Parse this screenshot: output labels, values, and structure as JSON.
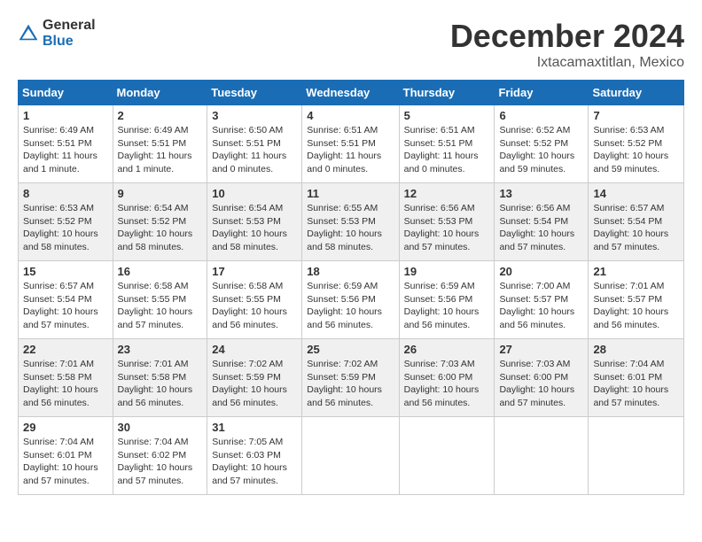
{
  "header": {
    "logo_general": "General",
    "logo_blue": "Blue",
    "month_title": "December 2024",
    "location": "Ixtacamaxtitlan, Mexico"
  },
  "weekdays": [
    "Sunday",
    "Monday",
    "Tuesday",
    "Wednesday",
    "Thursday",
    "Friday",
    "Saturday"
  ],
  "weeks": [
    [
      {
        "day": "1",
        "sunrise": "6:49 AM",
        "sunset": "5:51 PM",
        "daylight": "11 hours and 1 minute."
      },
      {
        "day": "2",
        "sunrise": "6:49 AM",
        "sunset": "5:51 PM",
        "daylight": "11 hours and 1 minute."
      },
      {
        "day": "3",
        "sunrise": "6:50 AM",
        "sunset": "5:51 PM",
        "daylight": "11 hours and 0 minutes."
      },
      {
        "day": "4",
        "sunrise": "6:51 AM",
        "sunset": "5:51 PM",
        "daylight": "11 hours and 0 minutes."
      },
      {
        "day": "5",
        "sunrise": "6:51 AM",
        "sunset": "5:51 PM",
        "daylight": "11 hours and 0 minutes."
      },
      {
        "day": "6",
        "sunrise": "6:52 AM",
        "sunset": "5:52 PM",
        "daylight": "10 hours and 59 minutes."
      },
      {
        "day": "7",
        "sunrise": "6:53 AM",
        "sunset": "5:52 PM",
        "daylight": "10 hours and 59 minutes."
      }
    ],
    [
      {
        "day": "8",
        "sunrise": "6:53 AM",
        "sunset": "5:52 PM",
        "daylight": "10 hours and 58 minutes."
      },
      {
        "day": "9",
        "sunrise": "6:54 AM",
        "sunset": "5:52 PM",
        "daylight": "10 hours and 58 minutes."
      },
      {
        "day": "10",
        "sunrise": "6:54 AM",
        "sunset": "5:53 PM",
        "daylight": "10 hours and 58 minutes."
      },
      {
        "day": "11",
        "sunrise": "6:55 AM",
        "sunset": "5:53 PM",
        "daylight": "10 hours and 58 minutes."
      },
      {
        "day": "12",
        "sunrise": "6:56 AM",
        "sunset": "5:53 PM",
        "daylight": "10 hours and 57 minutes."
      },
      {
        "day": "13",
        "sunrise": "6:56 AM",
        "sunset": "5:54 PM",
        "daylight": "10 hours and 57 minutes."
      },
      {
        "day": "14",
        "sunrise": "6:57 AM",
        "sunset": "5:54 PM",
        "daylight": "10 hours and 57 minutes."
      }
    ],
    [
      {
        "day": "15",
        "sunrise": "6:57 AM",
        "sunset": "5:54 PM",
        "daylight": "10 hours and 57 minutes."
      },
      {
        "day": "16",
        "sunrise": "6:58 AM",
        "sunset": "5:55 PM",
        "daylight": "10 hours and 57 minutes."
      },
      {
        "day": "17",
        "sunrise": "6:58 AM",
        "sunset": "5:55 PM",
        "daylight": "10 hours and 56 minutes."
      },
      {
        "day": "18",
        "sunrise": "6:59 AM",
        "sunset": "5:56 PM",
        "daylight": "10 hours and 56 minutes."
      },
      {
        "day": "19",
        "sunrise": "6:59 AM",
        "sunset": "5:56 PM",
        "daylight": "10 hours and 56 minutes."
      },
      {
        "day": "20",
        "sunrise": "7:00 AM",
        "sunset": "5:57 PM",
        "daylight": "10 hours and 56 minutes."
      },
      {
        "day": "21",
        "sunrise": "7:01 AM",
        "sunset": "5:57 PM",
        "daylight": "10 hours and 56 minutes."
      }
    ],
    [
      {
        "day": "22",
        "sunrise": "7:01 AM",
        "sunset": "5:58 PM",
        "daylight": "10 hours and 56 minutes."
      },
      {
        "day": "23",
        "sunrise": "7:01 AM",
        "sunset": "5:58 PM",
        "daylight": "10 hours and 56 minutes."
      },
      {
        "day": "24",
        "sunrise": "7:02 AM",
        "sunset": "5:59 PM",
        "daylight": "10 hours and 56 minutes."
      },
      {
        "day": "25",
        "sunrise": "7:02 AM",
        "sunset": "5:59 PM",
        "daylight": "10 hours and 56 minutes."
      },
      {
        "day": "26",
        "sunrise": "7:03 AM",
        "sunset": "6:00 PM",
        "daylight": "10 hours and 56 minutes."
      },
      {
        "day": "27",
        "sunrise": "7:03 AM",
        "sunset": "6:00 PM",
        "daylight": "10 hours and 57 minutes."
      },
      {
        "day": "28",
        "sunrise": "7:04 AM",
        "sunset": "6:01 PM",
        "daylight": "10 hours and 57 minutes."
      }
    ],
    [
      {
        "day": "29",
        "sunrise": "7:04 AM",
        "sunset": "6:01 PM",
        "daylight": "10 hours and 57 minutes."
      },
      {
        "day": "30",
        "sunrise": "7:04 AM",
        "sunset": "6:02 PM",
        "daylight": "10 hours and 57 minutes."
      },
      {
        "day": "31",
        "sunrise": "7:05 AM",
        "sunset": "6:03 PM",
        "daylight": "10 hours and 57 minutes."
      },
      null,
      null,
      null,
      null
    ]
  ]
}
